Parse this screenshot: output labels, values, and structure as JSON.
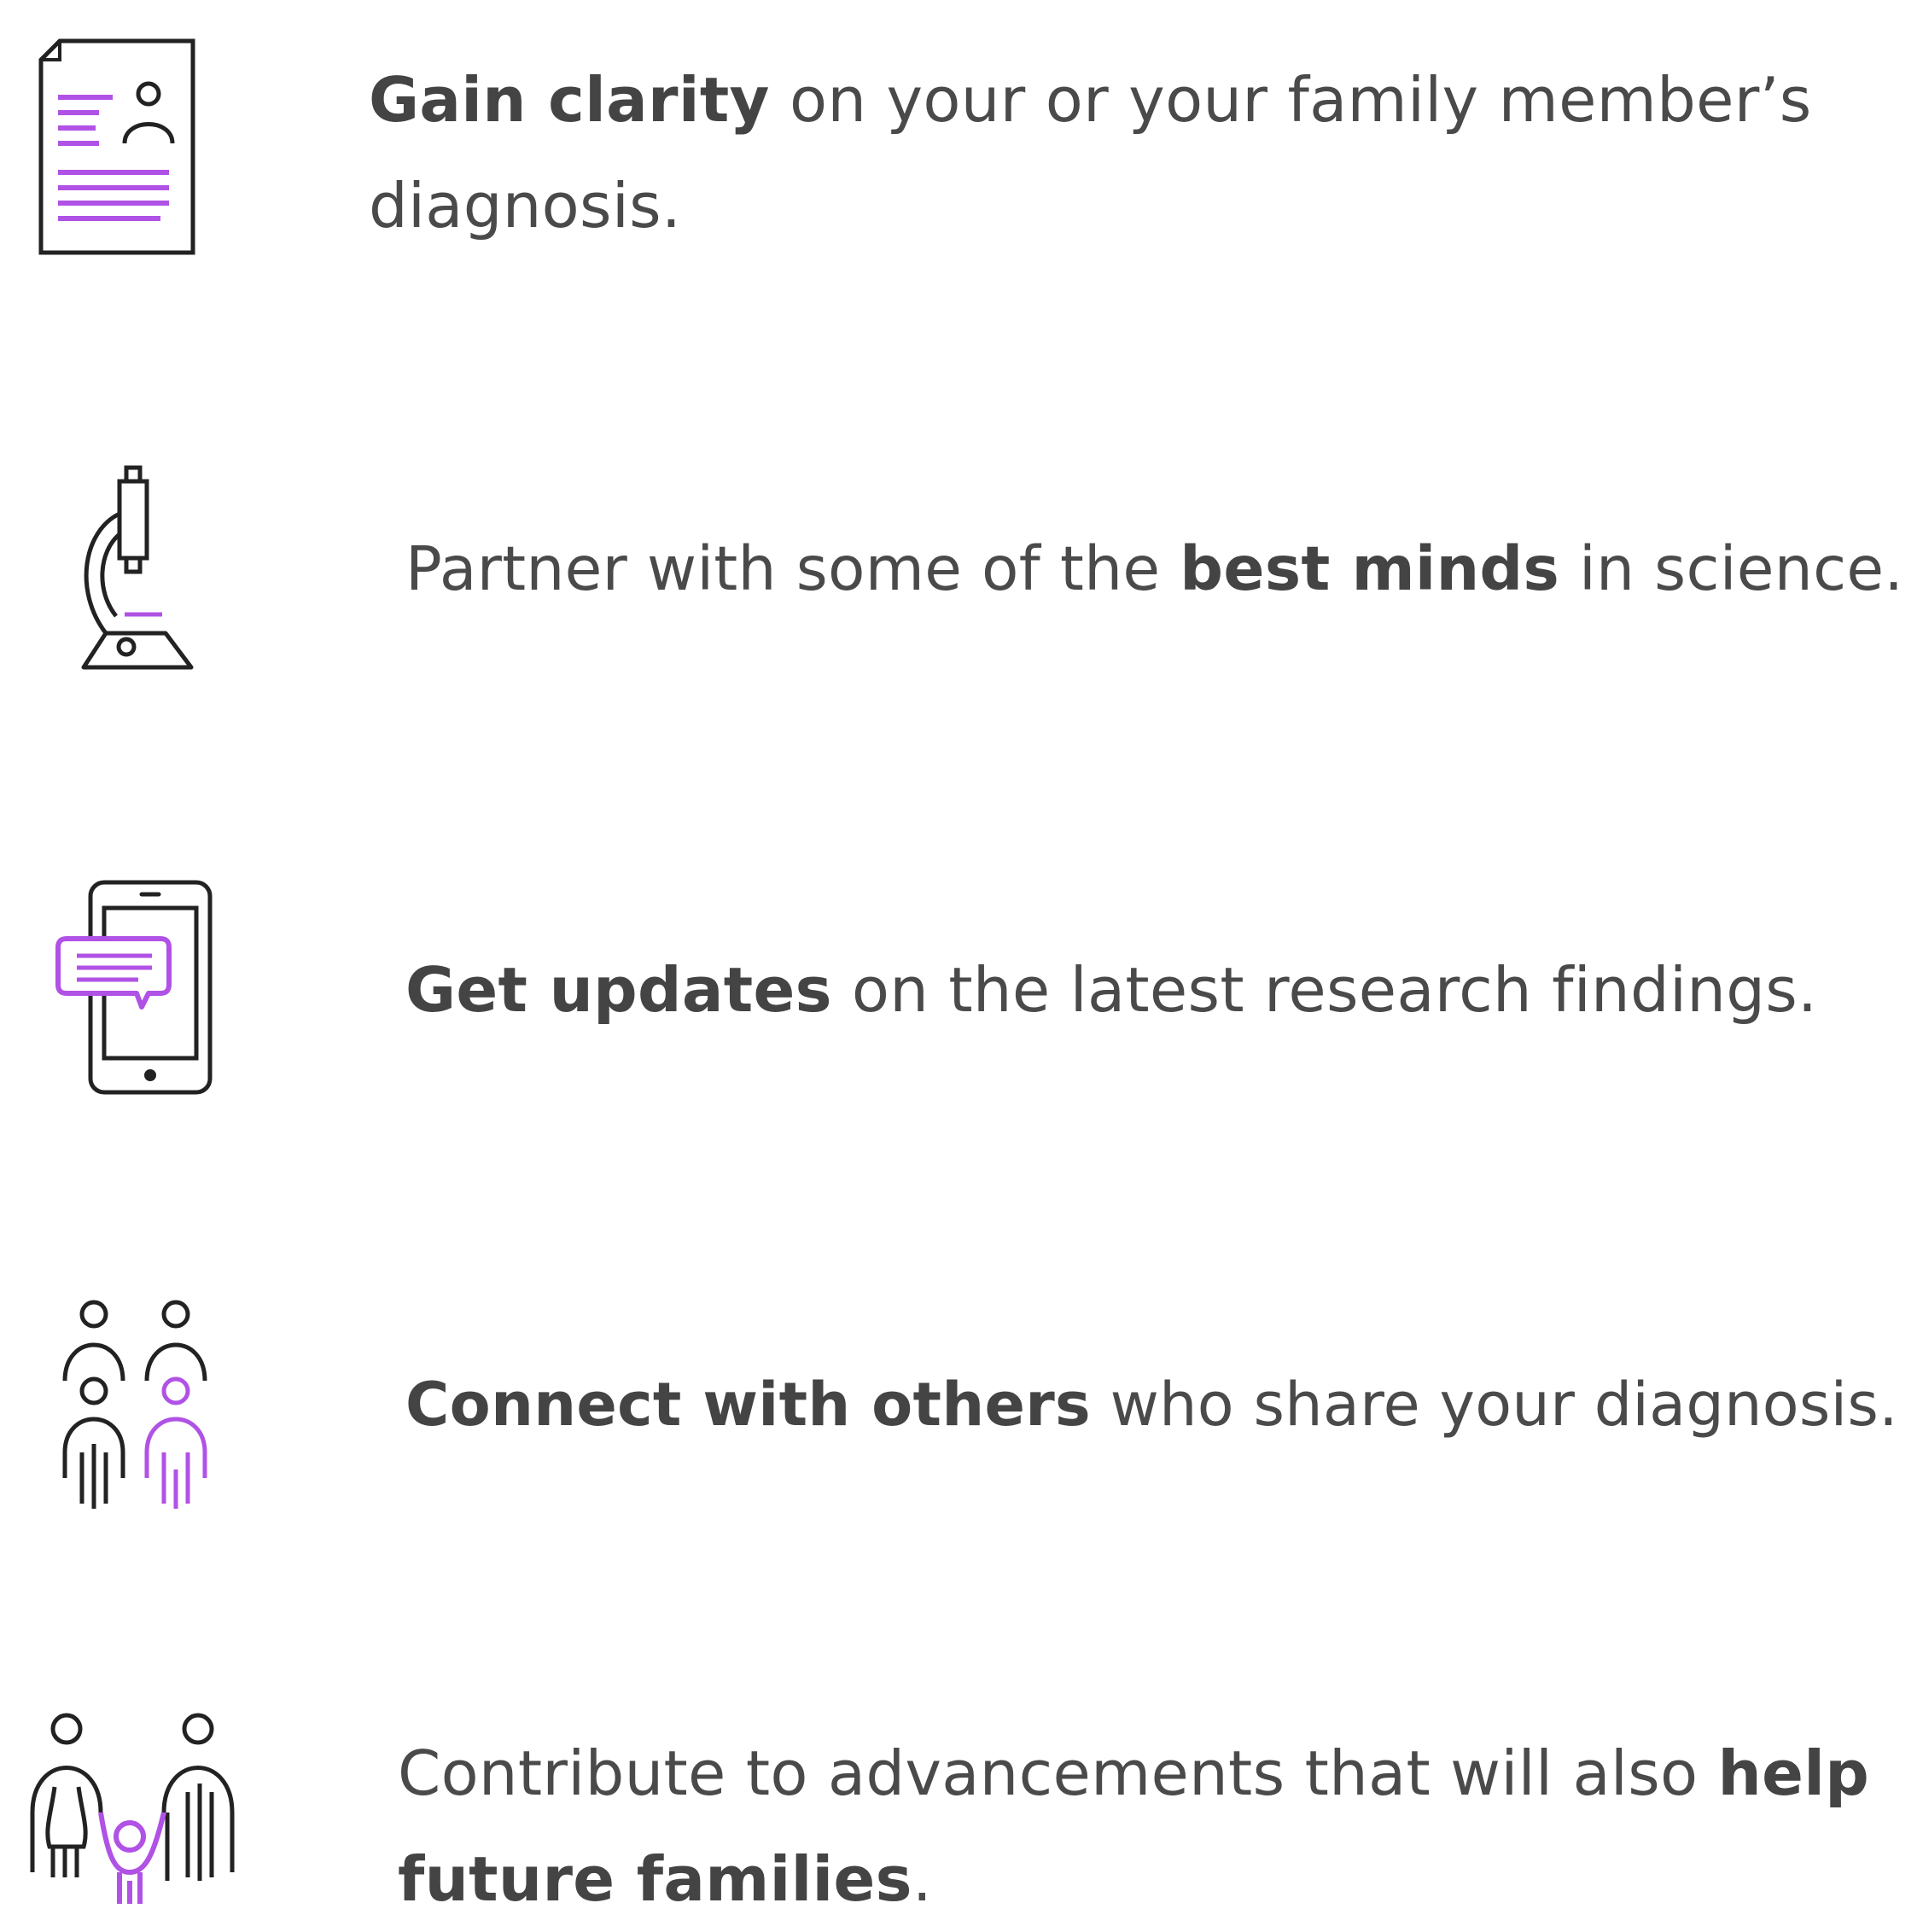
{
  "colors": {
    "text": "#4a4a4a",
    "strong_text": "#444444",
    "icon_dark": "#222222",
    "icon_accent": "#b052e6"
  },
  "benefits": [
    {
      "icon": "document-person-icon",
      "lines": [
        {
          "bold": "Gain clarity",
          "rest": " on your or your family member’s"
        },
        {
          "plain": "diagnosis."
        }
      ]
    },
    {
      "icon": "microscope-icon",
      "pre": "Partner with some of the ",
      "bold": "best minds",
      "post": " in science."
    },
    {
      "icon": "phone-chat-icon",
      "bold": "Get updates",
      "post": " on the latest research findings."
    },
    {
      "icon": "people-group-icon",
      "bold": "Connect with others",
      "post": " who share your diagnosis."
    },
    {
      "icon": "family-icon",
      "line1_pre": "Contribute to advancements that will also ",
      "line1_bold": "help",
      "line2_bold": "future families",
      "line2_post": "."
    }
  ]
}
